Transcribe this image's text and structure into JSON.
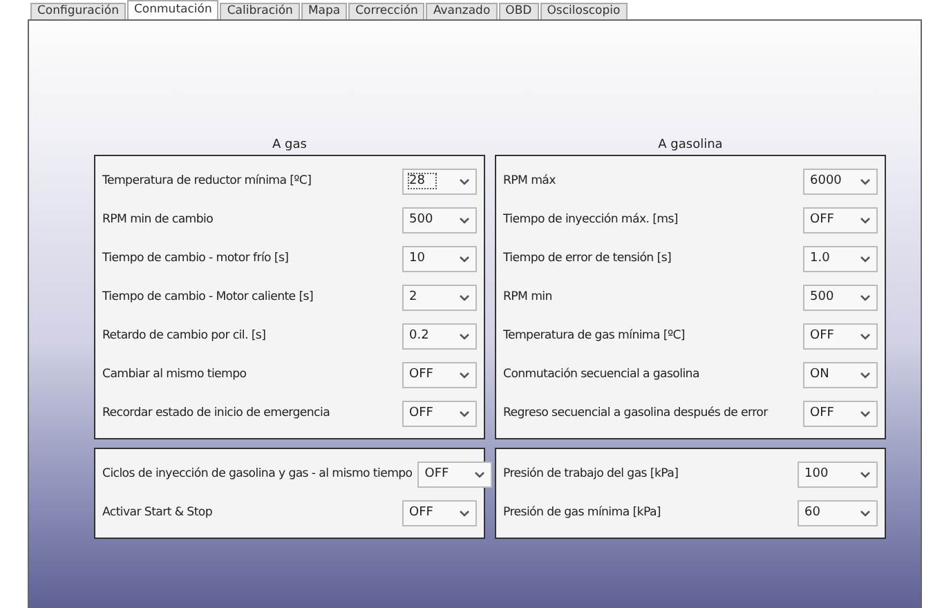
{
  "tabs": [
    {
      "label": "Configuración",
      "selected": false
    },
    {
      "label": "Conmutación",
      "selected": true
    },
    {
      "label": "Calibración",
      "selected": false
    },
    {
      "label": "Mapa",
      "selected": false
    },
    {
      "label": "Corrección",
      "selected": false
    },
    {
      "label": "Avanzado",
      "selected": false
    },
    {
      "label": "OBD",
      "selected": false
    },
    {
      "label": "Osciloscopio",
      "selected": false
    }
  ],
  "groups": [
    {
      "title": "A gas",
      "rows": [
        {
          "label": "Temperatura de reductor mínima  [ºC]",
          "value": "28",
          "focused": true
        },
        {
          "label": "RPM min de cambio",
          "value": "500",
          "focused": false
        },
        {
          "label": "Tiempo de cambio - motor frío [s]",
          "value": "10",
          "focused": false
        },
        {
          "label": "Tiempo de cambio - Motor caliente [s]",
          "value": "2",
          "focused": false
        },
        {
          "label": "Retardo de cambio por cil. [s]",
          "value": "0.2",
          "focused": false
        },
        {
          "label": "Cambiar al mismo tiempo",
          "value": "OFF",
          "focused": false
        },
        {
          "label": "Recordar estado de inicio de emergencia",
          "value": "OFF",
          "focused": false
        }
      ]
    },
    {
      "title": "A gasolina",
      "rows": [
        {
          "label": "RPM máx",
          "value": "6000",
          "focused": false
        },
        {
          "label": "Tiempo de inyección máx. [ms]",
          "value": "OFF",
          "focused": false
        },
        {
          "label": "Tiempo de error de tensión [s]",
          "value": "1.0",
          "focused": false
        },
        {
          "label": "RPM min",
          "value": "500",
          "focused": false
        },
        {
          "label": "Temperatura de gas mínima  [ºC]",
          "value": "OFF",
          "focused": false
        },
        {
          "label": "Conmutación secuencial a gasolina",
          "value": "ON",
          "focused": false
        },
        {
          "label": "Regreso secuencial a gasolina después de error",
          "value": "OFF",
          "focused": false
        }
      ]
    }
  ],
  "extra_groups": [
    {
      "rows": [
        {
          "label": "Ciclos de inyección de gasolina y gas - al mismo tiempo",
          "value": "OFF",
          "focused": false
        },
        {
          "label": "Activar Start & Stop",
          "value": "OFF",
          "focused": false
        }
      ]
    },
    {
      "rows": [
        {
          "label": "Presión de trabajo del gas  [kPa]",
          "value": "100",
          "focused": false
        },
        {
          "label": "Presión de gas mínima  [kPa]",
          "value": "60",
          "focused": false
        }
      ]
    }
  ]
}
